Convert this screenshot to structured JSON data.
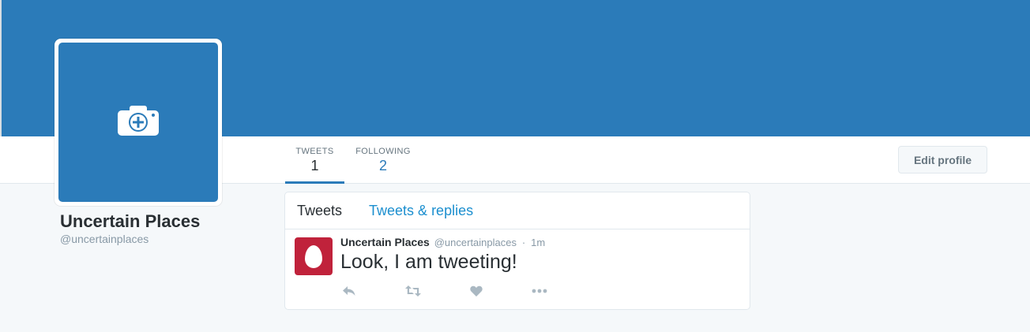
{
  "profile": {
    "name": "Uncertain Places",
    "handle": "@uncertainplaces"
  },
  "stats": {
    "tweets_label": "TWEETS",
    "tweets_count": "1",
    "following_label": "FOLLOWING",
    "following_count": "2"
  },
  "buttons": {
    "edit_profile": "Edit profile"
  },
  "timeline": {
    "tabs": [
      {
        "label": "Tweets",
        "active": true
      },
      {
        "label": "Tweets & replies",
        "active": false
      }
    ],
    "tweets": [
      {
        "name": "Uncertain Places",
        "handle": "@uncertainplaces",
        "separator": "·",
        "time": "1m",
        "text": "Look, I am tweeting!",
        "actions": [
          "reply-icon",
          "retweet-icon",
          "like-icon",
          "more-icon"
        ]
      }
    ]
  },
  "icons": {
    "avatar_upload": "camera-plus-icon",
    "tweet_avatar": "egg-avatar-icon"
  },
  "colors": {
    "brand_blue": "#2b7bb9",
    "link_blue": "#1c8fcf",
    "egg_red": "#c0223b",
    "text_dark": "#292f33",
    "text_muted": "#8899a6",
    "background": "#f5f8fa"
  }
}
